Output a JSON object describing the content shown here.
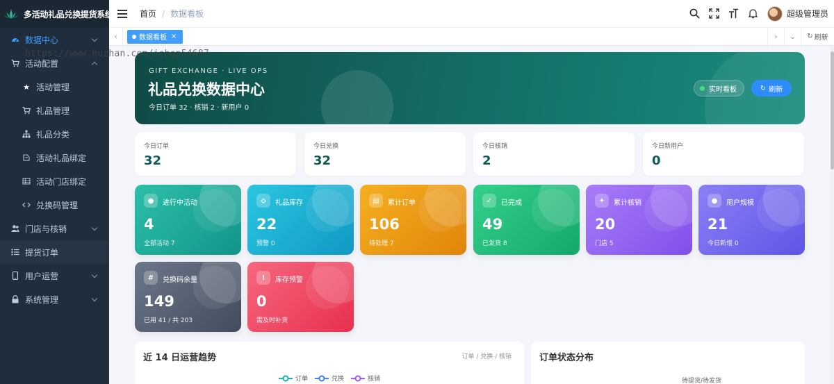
{
  "app": {
    "title": "多活动礼品兑换提货系统"
  },
  "watermark": "https://www.huzhan.com/ishop54687",
  "sidebar": {
    "items": [
      {
        "label": "数据中心",
        "icon": "dashboard-icon"
      },
      {
        "label": "活动配置",
        "icon": "cart-icon"
      },
      {
        "label": "活动管理",
        "icon": "star-icon"
      },
      {
        "label": "礼品管理",
        "icon": "cart-icon"
      },
      {
        "label": "礼品分类",
        "icon": "tree-icon"
      },
      {
        "label": "活动礼品绑定",
        "icon": "link-icon"
      },
      {
        "label": "活动门店绑定",
        "icon": "grid-icon"
      },
      {
        "label": "兑换码管理",
        "icon": "code-icon"
      },
      {
        "label": "门店与核销",
        "icon": "users-icon"
      },
      {
        "label": "提货订单",
        "icon": "list-icon"
      },
      {
        "label": "用户运营",
        "icon": "phone-icon"
      },
      {
        "label": "系统管理",
        "icon": "lock-icon"
      }
    ]
  },
  "header": {
    "breadcrumb": [
      "首页",
      "数据看板"
    ],
    "user_name": "超级管理员"
  },
  "tags": {
    "active": "数据看板",
    "close": "×",
    "refresh": "刷新"
  },
  "hero": {
    "eyebrow": "GIFT EXCHANGE · LIVE OPS",
    "title": "礼品兑换数据中心",
    "subtitle": "今日订单 32 · 核销 2 · 新用户 0",
    "live_label": "实时看板",
    "refresh_label": "刷新"
  },
  "stats": [
    {
      "label": "今日订单",
      "value": "32"
    },
    {
      "label": "今日兑换",
      "value": "32"
    },
    {
      "label": "今日核销",
      "value": "2"
    },
    {
      "label": "今日新用户",
      "value": "0"
    }
  ],
  "kpis": [
    {
      "title": "进行中活动",
      "value": "4",
      "sub": "全部活动 7",
      "badge": "●",
      "colors": [
        "#2dbfa8",
        "#12958a"
      ]
    },
    {
      "title": "礼品库存",
      "value": "22",
      "sub": "预警 0",
      "badge": "⬦",
      "colors": [
        "#2ac6e0",
        "#1099c4"
      ]
    },
    {
      "title": "累计订单",
      "value": "106",
      "sub": "待处理 7",
      "badge": "▤",
      "colors": [
        "#f5b021",
        "#e1840a"
      ]
    },
    {
      "title": "已完成",
      "value": "49",
      "sub": "已发货 8",
      "badge": "✓",
      "colors": [
        "#34d08a",
        "#13a86b"
      ]
    },
    {
      "title": "累计核销",
      "value": "20",
      "sub": "门店 5",
      "badge": "✦",
      "colors": [
        "#a77cf8",
        "#8150ea"
      ]
    },
    {
      "title": "用户规模",
      "value": "21",
      "sub": "今日新增 0",
      "badge": "●",
      "colors": [
        "#8a80f5",
        "#5f55e6"
      ]
    },
    {
      "title": "兑换码余量",
      "value": "149",
      "sub": "已用 41 / 共 203",
      "badge": "#",
      "colors": [
        "#6c7689",
        "#434c5e"
      ]
    },
    {
      "title": "库存预警",
      "value": "0",
      "sub": "需及时补货",
      "badge": "!",
      "colors": [
        "#f6677f",
        "#e8304f"
      ]
    }
  ],
  "trend_panel": {
    "title": "近 14 日运营趋势",
    "meta": "订单 / 兑换 / 核销",
    "legend": [
      {
        "name": "订单",
        "color": "#12b5a0"
      },
      {
        "name": "兑换",
        "color": "#3b82f6"
      },
      {
        "name": "核销",
        "color": "#a855f7"
      }
    ]
  },
  "status_panel": {
    "title": "订单状态分布",
    "first_label": "待提货/待发货"
  }
}
